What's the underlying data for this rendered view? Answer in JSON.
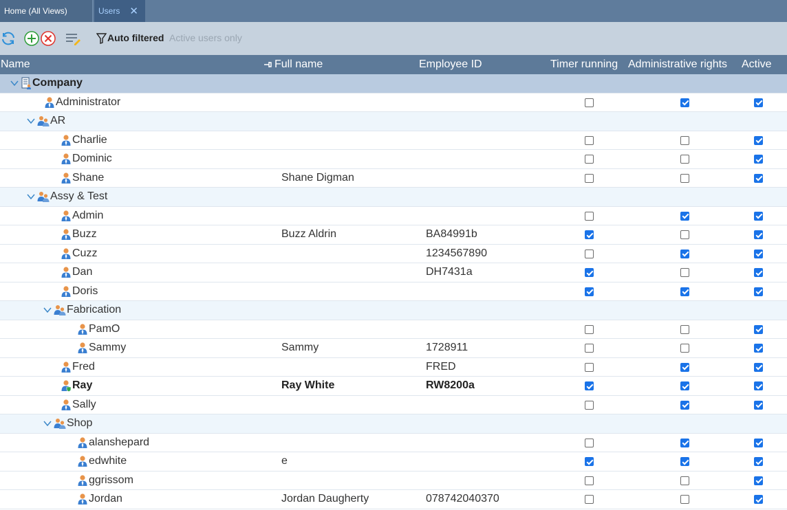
{
  "tabs": [
    {
      "label": "Home (All Views)"
    },
    {
      "label": "Users",
      "close": "✕"
    }
  ],
  "toolbar": {
    "filter_label": "Auto filtered",
    "filter_desc": "Active users only"
  },
  "columns": {
    "name": "Name",
    "full_name": "Full name",
    "employee_id": "Employee ID",
    "timer": "Timer running",
    "admin": "Administrative rights",
    "active": "Active"
  },
  "rows": [
    {
      "type": "root",
      "name": "Company",
      "level": 0
    },
    {
      "type": "user",
      "name": "Administrator",
      "level": 1,
      "full": "",
      "emp": "",
      "timer": false,
      "admin": true,
      "active": true
    },
    {
      "type": "group",
      "name": "AR",
      "level": 1
    },
    {
      "type": "user",
      "name": "Charlie",
      "level": 2,
      "full": "",
      "emp": "",
      "timer": false,
      "admin": false,
      "active": true
    },
    {
      "type": "user",
      "name": "Dominic",
      "level": 2,
      "full": "",
      "emp": "",
      "timer": false,
      "admin": false,
      "active": true
    },
    {
      "type": "user",
      "name": "Shane",
      "level": 2,
      "full": "Shane Digman",
      "emp": "",
      "timer": false,
      "admin": false,
      "active": true
    },
    {
      "type": "group",
      "name": "Assy & Test",
      "level": 1
    },
    {
      "type": "user",
      "name": "Admin",
      "level": 2,
      "full": "",
      "emp": "",
      "timer": false,
      "admin": true,
      "active": true
    },
    {
      "type": "user",
      "name": "Buzz",
      "level": 2,
      "full": "Buzz Aldrin",
      "emp": "BA84991b",
      "timer": true,
      "admin": false,
      "active": true
    },
    {
      "type": "user",
      "name": "Cuzz",
      "level": 2,
      "full": "",
      "emp": "1234567890",
      "timer": false,
      "admin": true,
      "active": true
    },
    {
      "type": "user",
      "name": "Dan",
      "level": 2,
      "full": "",
      "emp": "DH7431a",
      "timer": true,
      "admin": false,
      "active": true
    },
    {
      "type": "user",
      "name": "Doris",
      "level": 2,
      "full": "",
      "emp": "",
      "timer": true,
      "admin": true,
      "active": true
    },
    {
      "type": "group",
      "name": "Fabrication",
      "level": 2
    },
    {
      "type": "user",
      "name": "PamO",
      "level": 3,
      "full": "",
      "emp": "",
      "timer": false,
      "admin": false,
      "active": true
    },
    {
      "type": "user",
      "name": "Sammy",
      "level": 3,
      "full": "Sammy",
      "emp": "1728911",
      "timer": false,
      "admin": false,
      "active": true
    },
    {
      "type": "user",
      "name": "Fred",
      "level": 2,
      "full": "",
      "emp": "FRED",
      "timer": false,
      "admin": true,
      "active": true
    },
    {
      "type": "user",
      "name": "Ray",
      "level": 2,
      "full": "Ray White",
      "emp": "RW8200a",
      "timer": true,
      "admin": true,
      "active": true,
      "bold": true,
      "current": true
    },
    {
      "type": "user",
      "name": "Sally",
      "level": 2,
      "full": "",
      "emp": "",
      "timer": false,
      "admin": true,
      "active": true
    },
    {
      "type": "group",
      "name": "Shop",
      "level": 2
    },
    {
      "type": "user",
      "name": "alanshepard",
      "level": 3,
      "full": "",
      "emp": "",
      "timer": false,
      "admin": true,
      "active": true
    },
    {
      "type": "user",
      "name": "edwhite",
      "level": 3,
      "full": "e",
      "emp": "",
      "timer": true,
      "admin": true,
      "active": true
    },
    {
      "type": "user",
      "name": "ggrissom",
      "level": 3,
      "full": "",
      "emp": "",
      "timer": false,
      "admin": false,
      "active": true
    },
    {
      "type": "user",
      "name": "Jordan",
      "level": 3,
      "full": "Jordan Daugherty",
      "emp": "078742040370",
      "timer": false,
      "admin": false,
      "active": true
    }
  ]
}
